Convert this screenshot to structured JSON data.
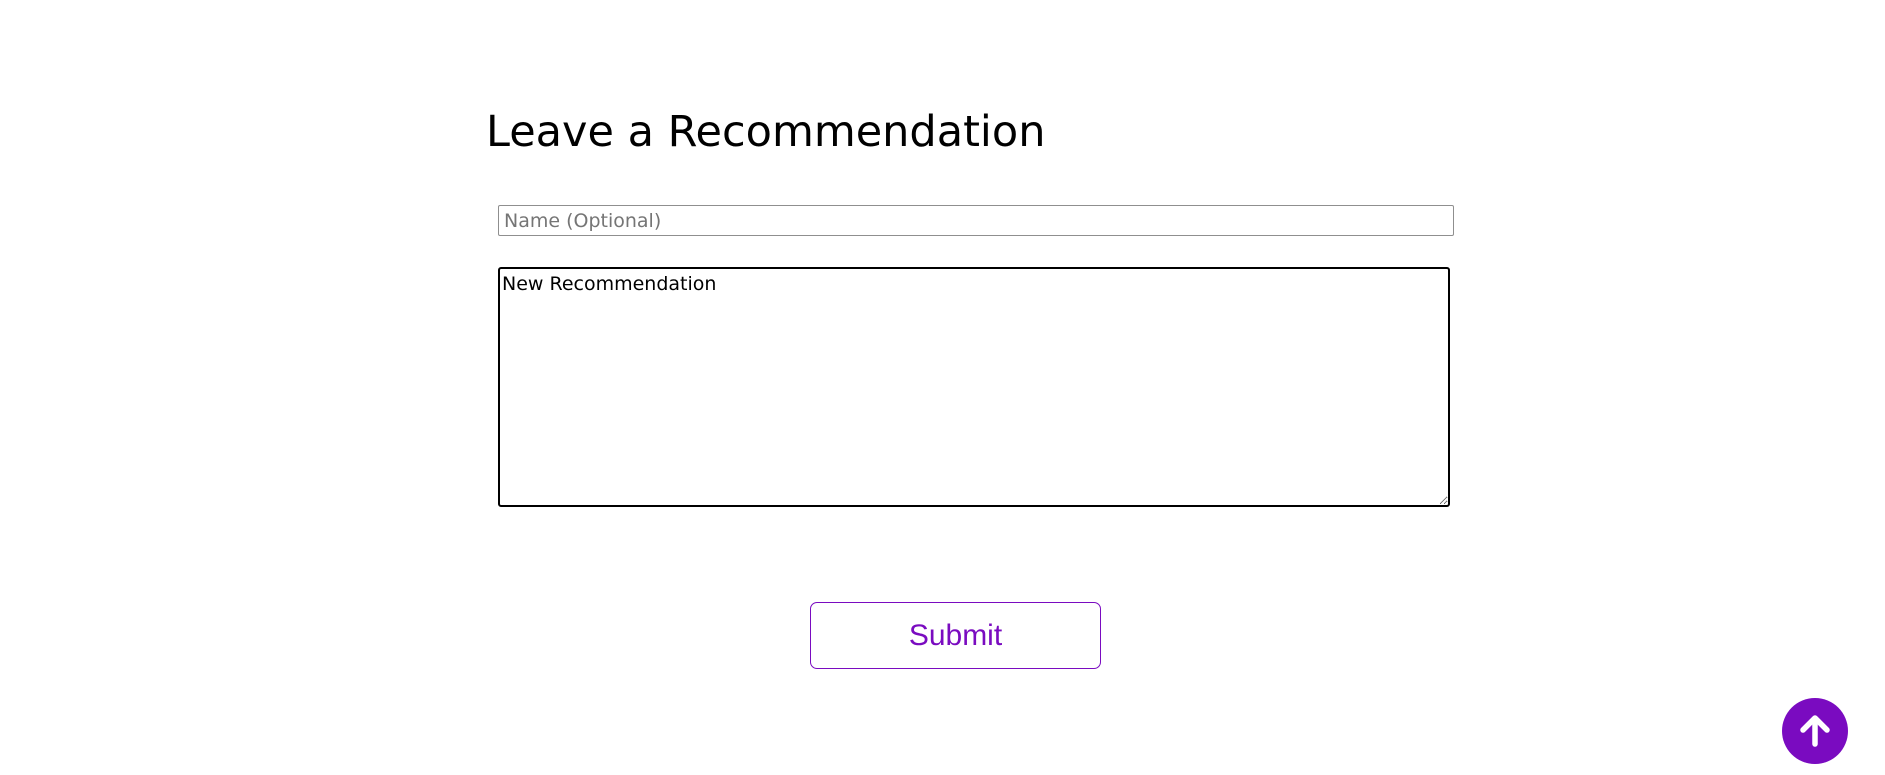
{
  "form": {
    "title": "Leave a Recommendation",
    "name_placeholder": "Name (Optional)",
    "name_value": "",
    "recommendation_value": "New Recommendation",
    "submit_label": "Submit"
  },
  "scroll_top": {
    "icon": "arrow-up-icon"
  },
  "colors": {
    "accent": "#7a0bc0",
    "text": "#000000",
    "background": "#ffffff"
  }
}
